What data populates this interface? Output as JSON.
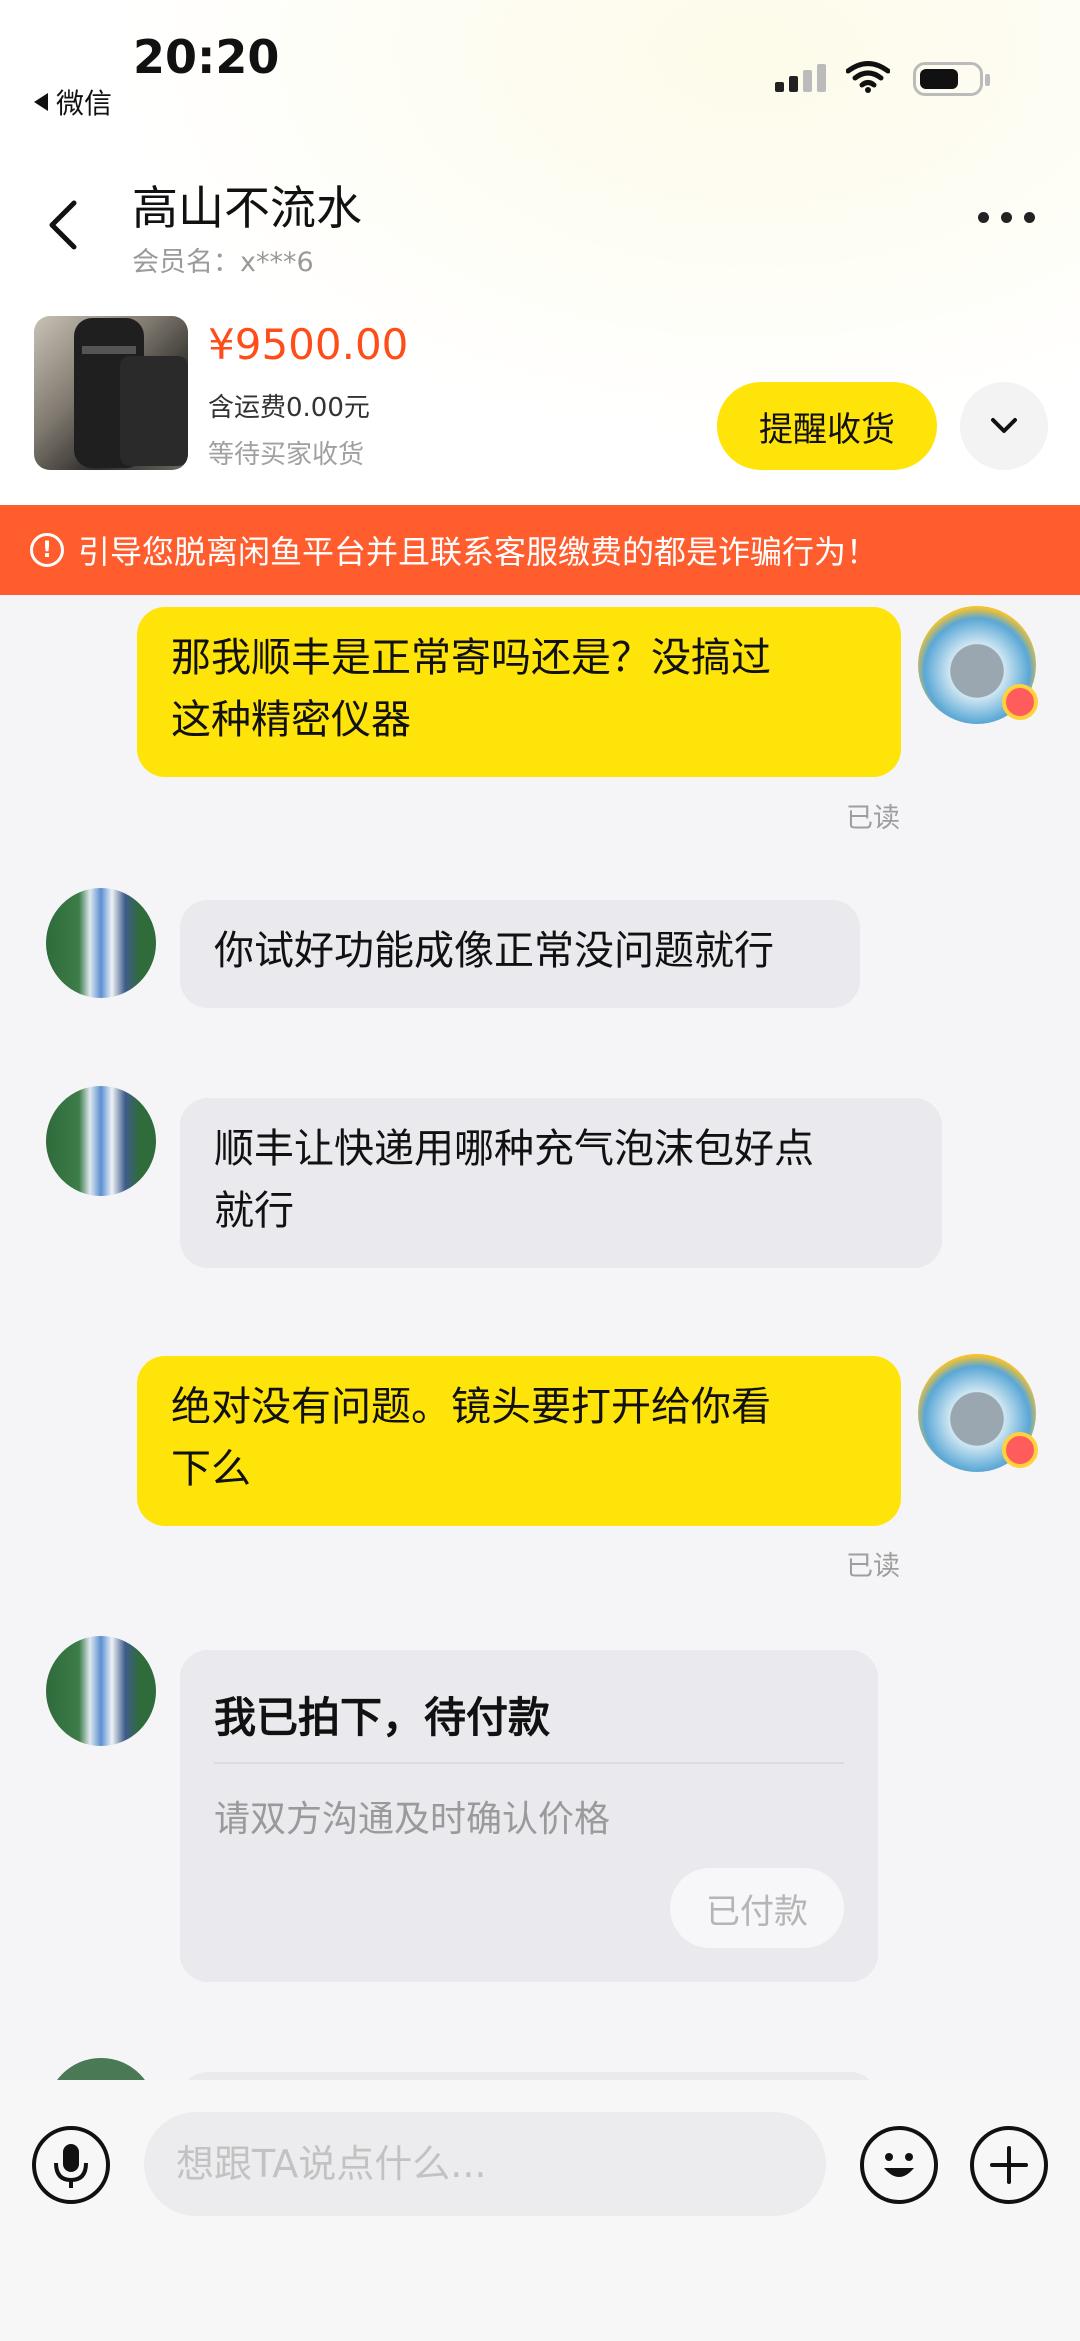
{
  "status_bar": {
    "time": "20:20",
    "back_app": "微信"
  },
  "header": {
    "title": "高山不流水",
    "subtitle": "会员名：x***6"
  },
  "product": {
    "price": "¥9500.00",
    "shipping": "含运费0.00元",
    "status": "等待买家收货",
    "action_label": "提醒收货"
  },
  "warning": {
    "text": "引导您脱离闲鱼平台并且联系客服缴费的都是诈骗行为！"
  },
  "messages": [
    {
      "from": "me",
      "text_line1": "那我顺丰是正常寄吗还是？没搞过",
      "text_line2": "这种精密仪器",
      "status": "已读"
    },
    {
      "from": "them",
      "text_line1": "你试好功能成像正常没问题就行"
    },
    {
      "from": "them",
      "text_line1": "顺丰让快递用哪种充气泡沫包好点",
      "text_line2": "就行"
    },
    {
      "from": "me",
      "text_line1": "绝对没有问题。镜头要打开给你看",
      "text_line2": "下么",
      "status": "已读"
    }
  ],
  "order_card": {
    "title": "我已拍下，待付款",
    "desc": "请双方沟通及时确认价格",
    "button": "已付款"
  },
  "avatar_badge": "闲鱼小红花",
  "input": {
    "placeholder": "想跟TA说点什么..."
  },
  "colors": {
    "accent_yellow": "#ffe40a",
    "warning_orange": "#ff5d2e",
    "price_red": "#ff4d1a"
  }
}
